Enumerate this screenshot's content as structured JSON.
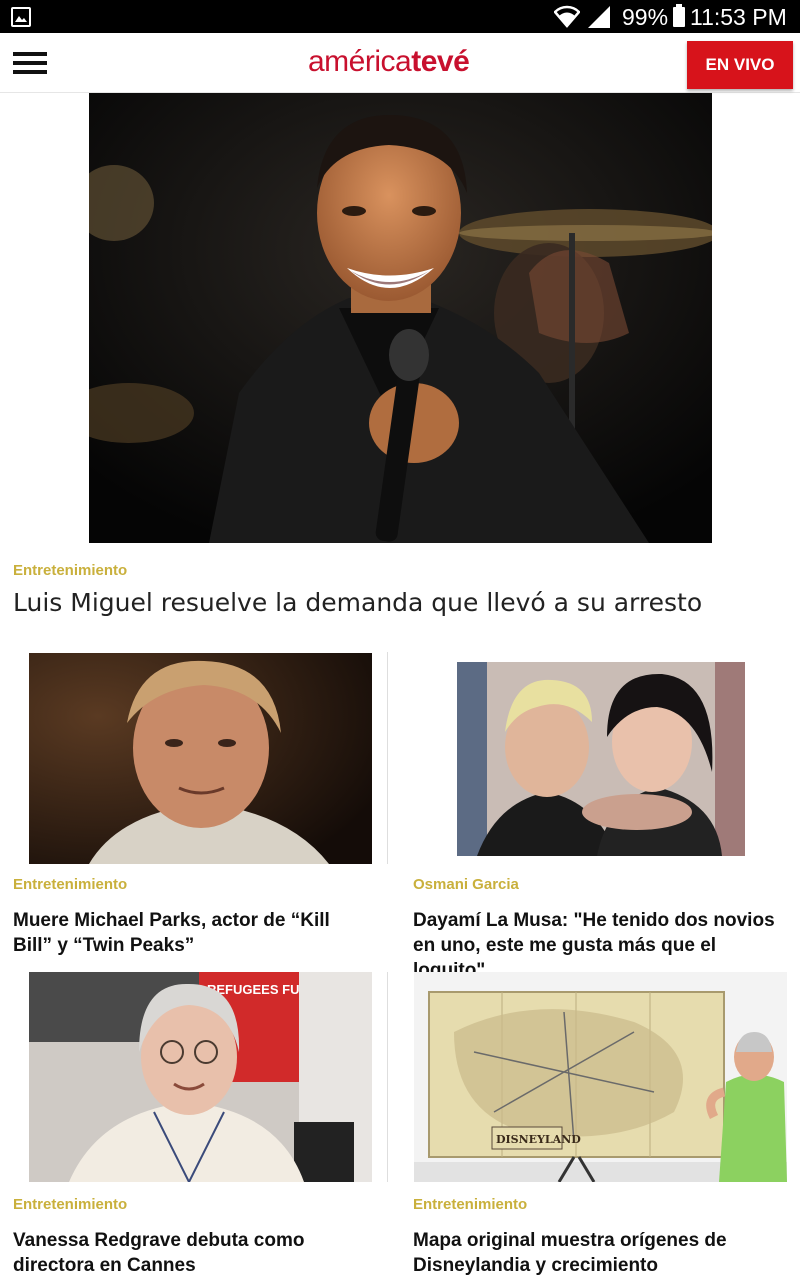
{
  "status_bar": {
    "battery": "99%",
    "time": "11:53 PM"
  },
  "header": {
    "logo_part1": "américa",
    "logo_part2": "tevé",
    "live_button": "EN VIVO"
  },
  "hero": {
    "category": "Entretenimiento",
    "title": "Luis Miguel resuelve la demanda que llevó a su arresto"
  },
  "cards": [
    {
      "category": "Entretenimiento",
      "title": "Muere Michael Parks, actor de “Kill Bill” y “Twin Peaks”"
    },
    {
      "category": "Osmani Garcia",
      "title": "Dayamí La Musa: \"He tenido dos novios en uno, este me gusta más que el loquito\""
    },
    {
      "category": "Entretenimiento",
      "title": "Vanessa Redgrave debuta como directora en Cannes"
    },
    {
      "category": "Entretenimiento",
      "title": "Mapa original muestra orígenes de Disneylandia y crecimiento"
    }
  ],
  "images": {
    "poster_text": "REFUGEES FUTURE",
    "map_label": "DISNEYLAND"
  },
  "colors": {
    "brand_red": "#d7131b",
    "category_gold": "#c9b03c"
  }
}
